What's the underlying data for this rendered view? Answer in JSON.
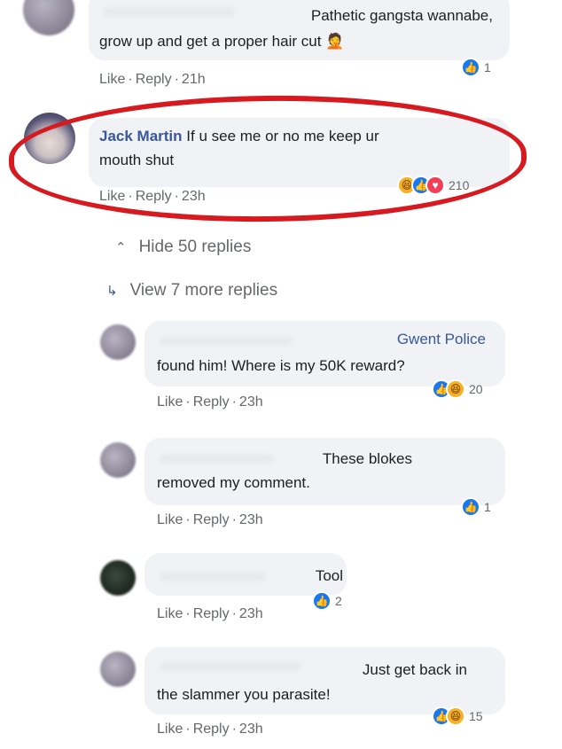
{
  "comments": [
    {
      "text_line1": "Pathetic gangsta wannabe,",
      "text_line2": "grow up and get a proper hair cut",
      "emoji": "🤦",
      "like": "Like",
      "reply": "Reply",
      "time": "21h",
      "reactions": "1"
    },
    {
      "author": "Jack Martin",
      "text_line1": "If u see me or no me keep ur",
      "text_line2": "mouth shut",
      "like": "Like",
      "reply": "Reply",
      "time": "23h",
      "reactions": "210"
    }
  ],
  "thread": {
    "hide": "Hide 50 replies",
    "more": "View 7 more replies"
  },
  "replies": [
    {
      "tag": "Gwent Police",
      "text_line1": "found him! Where is my 50K reward?",
      "like": "Like",
      "reply": "Reply",
      "time": "23h",
      "reactions": "20"
    },
    {
      "text_line1": "These blokes",
      "text_line2": "removed my comment.",
      "like": "Like",
      "reply": "Reply",
      "time": "23h",
      "reactions": "1"
    },
    {
      "text_line1": "Tool",
      "like": "Like",
      "reply": "Reply",
      "time": "23h",
      "reactions": "2"
    },
    {
      "text_line1": "Just get back in",
      "text_line2": "the slammer you parasite!",
      "like": "Like",
      "reply": "Reply",
      "time": "23h",
      "reactions": "15"
    }
  ],
  "colors": {
    "highlight": "#d71920",
    "link": "#385898",
    "like": "#1877f2"
  }
}
